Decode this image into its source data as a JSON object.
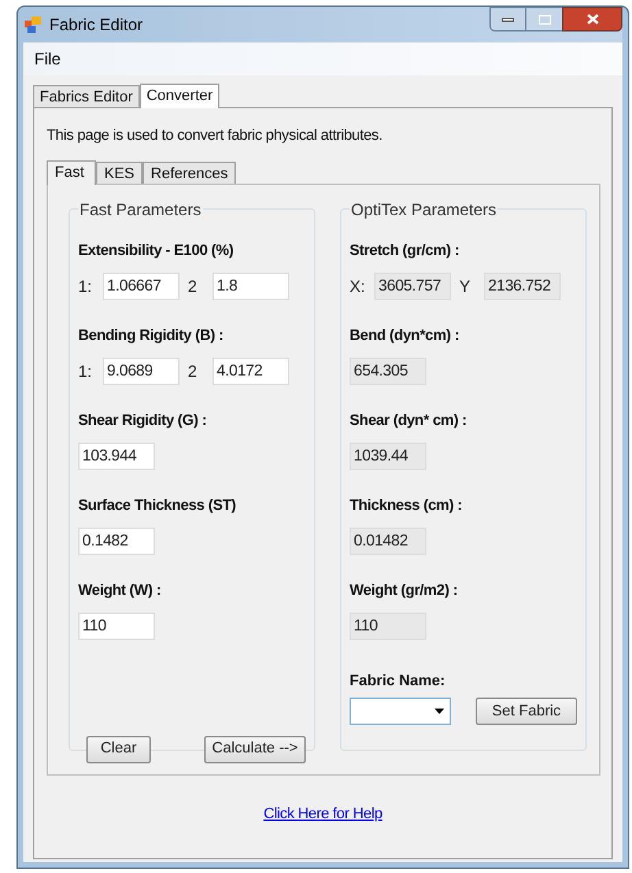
{
  "window": {
    "title": "Fabric Editor"
  },
  "menu": [
    "File"
  ],
  "tabs": [
    {
      "label": "Fabrics Editor",
      "selected": false
    },
    {
      "label": "Converter",
      "selected": true
    }
  ],
  "description": "This page is used to convert fabric physical attributes.",
  "inner_tabs": [
    {
      "label": "Fast",
      "selected": true
    },
    {
      "label": "KES",
      "selected": false
    },
    {
      "label": "References",
      "selected": false
    }
  ],
  "fast_parameters": {
    "title": "Fast Parameters",
    "read_only": false,
    "fields": [
      {
        "label": "Extensibility - E100 (%)",
        "inputs": [
          {
            "prefix": "1:",
            "value": "1.06667"
          },
          {
            "prefix": "2",
            "value": "1.8"
          }
        ]
      },
      {
        "label": "Bending Rigidity (B) :",
        "inputs": [
          {
            "prefix": "1:",
            "value": "9.0689"
          },
          {
            "prefix": "2",
            "value": "4.0172"
          }
        ]
      },
      {
        "label": "Shear Rigidity (G) :",
        "inputs": [
          {
            "value": "103.944"
          }
        ]
      },
      {
        "label": "Surface Thickness (ST)",
        "inputs": [
          {
            "value": "0.1482"
          }
        ]
      },
      {
        "label": "Weight (W) :",
        "inputs": [
          {
            "value": "110"
          }
        ]
      }
    ],
    "buttons": [
      "Clear",
      "Calculate -->"
    ]
  },
  "optitex_parameters": {
    "title": "OptiTex Parameters",
    "read_only": true,
    "fields": [
      {
        "label": "Stretch (gr/cm) :",
        "inputs": [
          {
            "prefix": "X:",
            "value": "3605.757"
          },
          {
            "prefix": "Y",
            "value": "2136.752"
          }
        ]
      },
      {
        "label": "Bend (dyn*cm) :",
        "inputs": [
          {
            "value": "654.305"
          }
        ]
      },
      {
        "label": "Shear (dyn* cm) :",
        "inputs": [
          {
            "value": "1039.44"
          }
        ]
      },
      {
        "label": "Thickness (cm) :",
        "inputs": [
          {
            "value": "0.01482"
          }
        ]
      },
      {
        "label": "Weight (gr/m2) :",
        "inputs": [
          {
            "value": "110"
          }
        ]
      }
    ],
    "fabric_name_label": "Fabric Name:",
    "buttons": [
      "Set Fabric"
    ]
  },
  "help_link": "Click Here for Help"
}
